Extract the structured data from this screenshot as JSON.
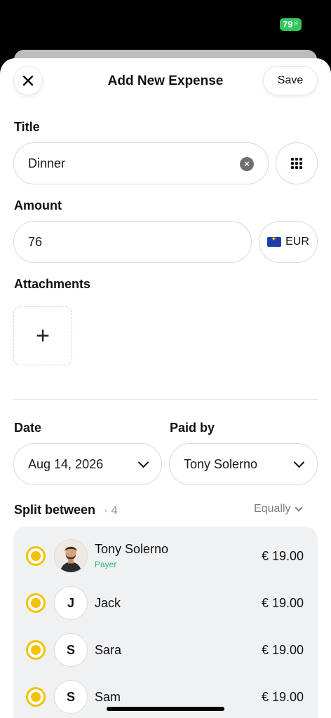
{
  "status_bar": {
    "battery": "79"
  },
  "header": {
    "title": "Add New Expense",
    "save_label": "Save"
  },
  "title_section": {
    "label": "Title",
    "value": "Dinner"
  },
  "amount_section": {
    "label": "Amount",
    "value": "76",
    "currency": "EUR"
  },
  "attachments": {
    "label": "Attachments",
    "add_symbol": "+"
  },
  "date": {
    "label": "Date",
    "value": "Aug 14, 2026"
  },
  "paid_by": {
    "label": "Paid by",
    "value": "Tony Solerno"
  },
  "split": {
    "label": "Split between",
    "count": "· 4",
    "mode": "Equally",
    "members": [
      {
        "name": "Tony Solerno",
        "sub": "Payer",
        "initial": "",
        "amount": "€ 19.00",
        "selected": true
      },
      {
        "name": "Jack",
        "sub": "",
        "initial": "J",
        "amount": "€ 19.00",
        "selected": true
      },
      {
        "name": "Sara",
        "sub": "",
        "initial": "S",
        "amount": "€ 19.00",
        "selected": true
      },
      {
        "name": "Sam",
        "sub": "",
        "initial": "S",
        "amount": "€ 19.00",
        "selected": true
      }
    ]
  },
  "colors": {
    "accent": "#f2c200",
    "payer_text": "#2bb673",
    "battery": "#34c759"
  }
}
